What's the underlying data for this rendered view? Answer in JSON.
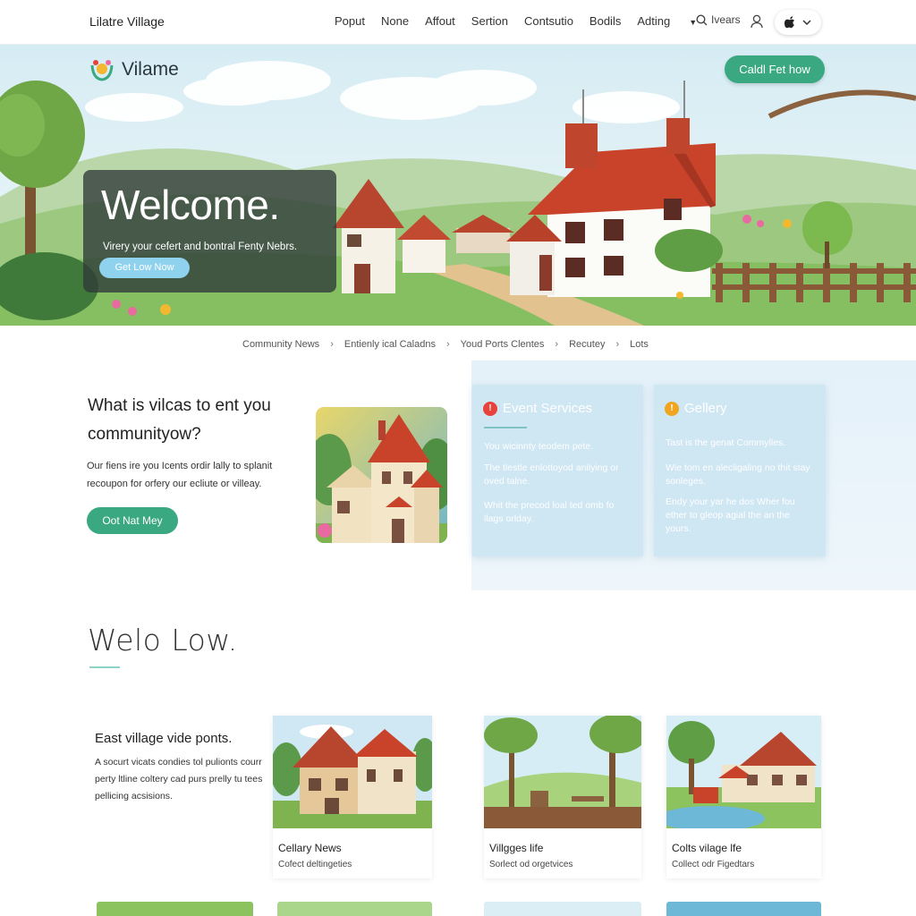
{
  "site": {
    "title": "Lilatre Village"
  },
  "nav": {
    "links": [
      "Poput",
      "None",
      "Affout",
      "Sertion",
      "Contsutio",
      "Bodils",
      "Adting"
    ],
    "search_label": "Ivears",
    "icons": [
      "search-icon",
      "user-icon",
      "apple-icon",
      "chevron-down-icon"
    ]
  },
  "hero": {
    "brand": "Vilame",
    "cta": "Caldl Fet how",
    "welcome_title": "Welcome.",
    "welcome_sub": "Virery your cefert and bontral Fenty Nebrs.",
    "welcome_btn": "Get Low Now"
  },
  "breadcrumb": [
    "Community News",
    "Entienly ical Caladns",
    "Youd Ports Clentes",
    "Recutey",
    "Lots"
  ],
  "intro": {
    "question": "What is vilcas to ent you communityow?",
    "body": "Our fiens ire you Icents ordir lally to splanit recoupon for orfery our ecliute or villeay.",
    "button": "Oot Nat Mey"
  },
  "services": [
    {
      "title": "Event Services",
      "badge": "!",
      "badge_color": "#e8423a",
      "lines": [
        "You wicinnty teodem pete.",
        "The tlestle enlottoyod anilying or oved talne.",
        "Whit the precod loal ted omb fo llags orlday."
      ]
    },
    {
      "title": "Gellery",
      "badge": "!",
      "badge_color": "#f0a520",
      "lines": [
        "Tast is the genat Commylles.",
        "Wie tom en alecligaling no thit stay sonleges.",
        "Endy your yar he dos Wher fou ether to gleop agial the an the yours."
      ]
    }
  ],
  "section2": {
    "title": "Welo Low.",
    "side_title": "East village vide ponts.",
    "side_body": "A socurt vicats condies tol pulionts courr perty ltline coltery cad purs prelly tu tees pellicing acsisions.",
    "cards": [
      {
        "title": "Cellary News",
        "subtitle": "Cofect deltingeties"
      },
      {
        "title": "Villgges life",
        "subtitle": "Sorlect od orgetvices"
      },
      {
        "title": "Colts vilage lfe",
        "subtitle": "Collect odr Figedtars"
      }
    ]
  },
  "colors": {
    "accent_green": "#3aa880",
    "light_blue_button": "#8fd2ee",
    "service_card": "#cfe6f3",
    "roof_red": "#c9422a"
  }
}
